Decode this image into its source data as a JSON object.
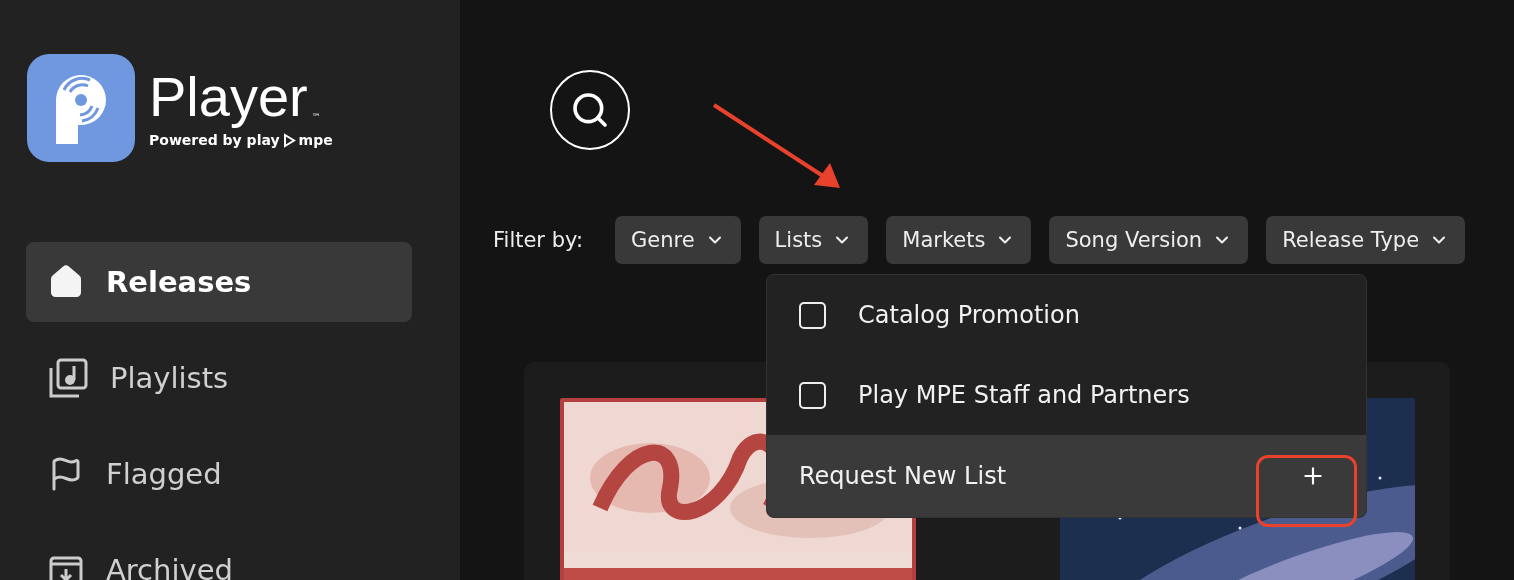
{
  "brand": {
    "title": "Player",
    "trademark": "™",
    "tagline": "Powered by play",
    "tagline_suffix": "mpe"
  },
  "sidebar": {
    "items": [
      {
        "label": "Releases",
        "selected": true
      },
      {
        "label": "Playlists",
        "selected": false
      },
      {
        "label": "Flagged",
        "selected": false
      },
      {
        "label": "Archived",
        "selected": false
      }
    ]
  },
  "filters": {
    "label": "Filter by:",
    "chips": [
      {
        "label": "Genre"
      },
      {
        "label": "Lists"
      },
      {
        "label": "Markets"
      },
      {
        "label": "Song Version"
      },
      {
        "label": "Release Type"
      }
    ]
  },
  "lists_menu": {
    "options": [
      {
        "label": "Catalog Promotion",
        "checked": false
      },
      {
        "label": "Play MPE Staff and Partners",
        "checked": false
      }
    ],
    "action": {
      "label": "Request New List"
    }
  }
}
